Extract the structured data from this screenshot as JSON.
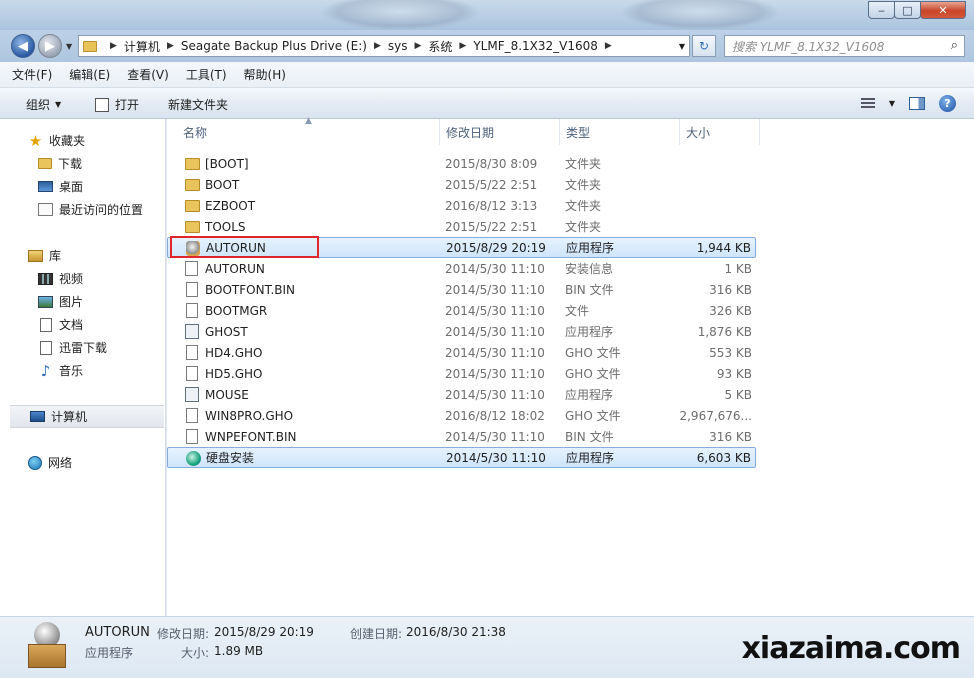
{
  "window": {
    "min_label": "‒",
    "max_label": "□",
    "close_label": "✕"
  },
  "address": {
    "crumbs": [
      "计算机",
      "Seagate Backup Plus Drive (E:)",
      "sys",
      "系统",
      "YLMF_8.1X32_V1608"
    ],
    "search_placeholder": "搜索 YLMF_8.1X32_V1608"
  },
  "menu": [
    "文件(F)",
    "编辑(E)",
    "查看(V)",
    "工具(T)",
    "帮助(H)"
  ],
  "toolbar": {
    "organize": "组织",
    "open": "打开",
    "new_folder": "新建文件夹"
  },
  "nav": {
    "favorites": "收藏夹",
    "downloads": "下载",
    "desktop": "桌面",
    "recent": "最近访问的位置",
    "libraries": "库",
    "videos": "视频",
    "pictures": "图片",
    "documents": "文档",
    "thunder": "迅雷下载",
    "music": "音乐",
    "computer": "计算机",
    "network": "网络"
  },
  "columns": {
    "name": "名称",
    "date": "修改日期",
    "type": "类型",
    "size": "大小"
  },
  "files": [
    {
      "name": "[BOOT]",
      "date": "2015/8/30 8:09",
      "type": "文件夹",
      "size": "",
      "icon": "folder-icon"
    },
    {
      "name": "BOOT",
      "date": "2015/5/22 2:51",
      "type": "文件夹",
      "size": "",
      "icon": "folder-icon"
    },
    {
      "name": "EZBOOT",
      "date": "2016/8/12 3:13",
      "type": "文件夹",
      "size": "",
      "icon": "folder-icon"
    },
    {
      "name": "TOOLS",
      "date": "2015/5/22 2:51",
      "type": "文件夹",
      "size": "",
      "icon": "folder-icon"
    },
    {
      "name": "AUTORUN",
      "date": "2015/8/29 20:19",
      "type": "应用程序",
      "size": "1,944 KB",
      "icon": "autorun-app-icon"
    },
    {
      "name": "AUTORUN",
      "date": "2014/5/30 11:10",
      "type": "安装信息",
      "size": "1 KB",
      "icon": "setup-info-icon"
    },
    {
      "name": "BOOTFONT.BIN",
      "date": "2014/5/30 11:10",
      "type": "BIN 文件",
      "size": "316 KB",
      "icon": "file-icon"
    },
    {
      "name": "BOOTMGR",
      "date": "2014/5/30 11:10",
      "type": "文件",
      "size": "326 KB",
      "icon": "file-icon"
    },
    {
      "name": "GHOST",
      "date": "2014/5/30 11:10",
      "type": "应用程序",
      "size": "1,876 KB",
      "icon": "app-icon"
    },
    {
      "name": "HD4.GHO",
      "date": "2014/5/30 11:10",
      "type": "GHO 文件",
      "size": "553 KB",
      "icon": "file-icon"
    },
    {
      "name": "HD5.GHO",
      "date": "2014/5/30 11:10",
      "type": "GHO 文件",
      "size": "93 KB",
      "icon": "file-icon"
    },
    {
      "name": "MOUSE",
      "date": "2014/5/30 11:10",
      "type": "应用程序",
      "size": "5 KB",
      "icon": "app-icon"
    },
    {
      "name": "WIN8PRO.GHO",
      "date": "2016/8/12 18:02",
      "type": "GHO 文件",
      "size": "2,967,676...",
      "icon": "file-icon"
    },
    {
      "name": "WNPEFONT.BIN",
      "date": "2014/5/30 11:10",
      "type": "BIN 文件",
      "size": "316 KB",
      "icon": "file-icon"
    },
    {
      "name": "硬盘安装",
      "date": "2014/5/30 11:10",
      "type": "应用程序",
      "size": "6,603 KB",
      "icon": "disk-install-icon"
    }
  ],
  "details": {
    "name": "AUTORUN",
    "modified_label": "修改日期:",
    "modified_value": "2015/8/29 20:19",
    "created_label": "创建日期:",
    "created_value": "2016/8/30 21:38",
    "type": "应用程序",
    "size_label": "大小:",
    "size_value": "1.89 MB"
  },
  "watermark": "xiazaima.com"
}
